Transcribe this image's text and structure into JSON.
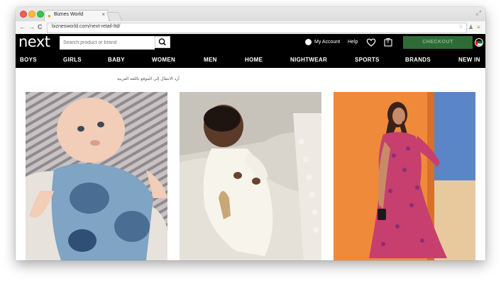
{
  "browser": {
    "tab_title": "Biznes World",
    "tab_close": "×",
    "url": "biznesworld.com/next-retail-ltd/",
    "nav_back": "←",
    "nav_forward": "→",
    "nav_reload": "C",
    "bookmark_star": "☆"
  },
  "header": {
    "logo": "next",
    "search_placeholder": "Search product or brand",
    "my_account": "My Account",
    "help": "Help",
    "bag_count": "0",
    "checkout": "CHECKOUT"
  },
  "nav": {
    "items": [
      "BOYS",
      "GIRLS",
      "BABY",
      "WOMEN",
      "MEN",
      "HOME",
      "NIGHTWEAR",
      "SPORTS",
      "BRANDS",
      "NEW IN"
    ]
  },
  "language_link": "أرد الانتقال إلى الموقع باللغة العربية",
  "products": [
    {
      "name": "baby-in-blue-dungarees"
    },
    {
      "name": "baby-in-white-sleepsuit"
    },
    {
      "name": "woman-in-pink-wrap-dress"
    }
  ],
  "colors": {
    "header_bg": "#000000",
    "checkout_bg": "#2e6b36"
  }
}
